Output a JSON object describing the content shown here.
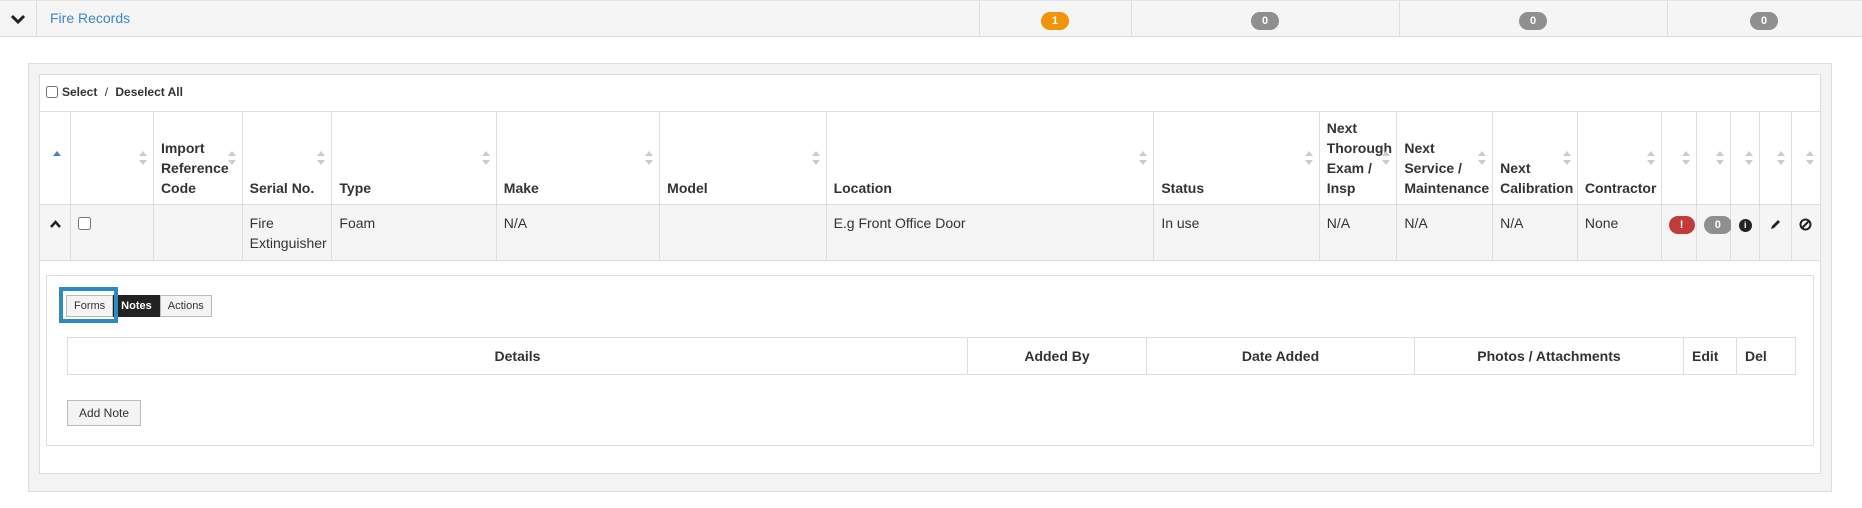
{
  "section": {
    "title": "Fire Records",
    "counts": [
      "1",
      "0",
      "0",
      "0"
    ]
  },
  "select_all": {
    "label_select": "Select",
    "label_sep": " / ",
    "label_deselect": "Deselect All"
  },
  "table": {
    "headers": [
      "",
      "",
      "Import Reference Code",
      "Serial No.",
      "Type",
      "Make",
      "Model",
      "Location",
      "Status",
      "Next Thorough Exam / Insp",
      "Next Service / Maintenance",
      "Next Calibration",
      "Contractor",
      "",
      "",
      "",
      "",
      ""
    ],
    "row": {
      "import_ref": "",
      "serial": "Fire Extinguisher",
      "type": "Foam",
      "make": "N/A",
      "model": "",
      "location": "E.g Front Office Door",
      "status": "In use",
      "next_exam": "N/A",
      "next_service": "N/A",
      "next_calibration": "N/A",
      "contractor": "None",
      "alert_badge": "!",
      "count_badge": "0"
    }
  },
  "detail": {
    "tabs": [
      "Forms",
      "Notes",
      "Actions"
    ],
    "active_tab": "Notes",
    "notes_headers": [
      "Details",
      "Added By",
      "Date Added",
      "Photos / Attachments",
      "Edit",
      "Del"
    ],
    "add_note_label": "Add Note"
  },
  "colors": {
    "link": "#3a87c8",
    "badge_orange": "#f0940a",
    "badge_grey": "#8f8f8f",
    "badge_red": "#c23b3b",
    "highlight": "#2f8ac2"
  },
  "icons": [
    "chevron-down-icon",
    "chevron-up-icon",
    "info-icon",
    "pencil-icon",
    "ban-icon"
  ]
}
